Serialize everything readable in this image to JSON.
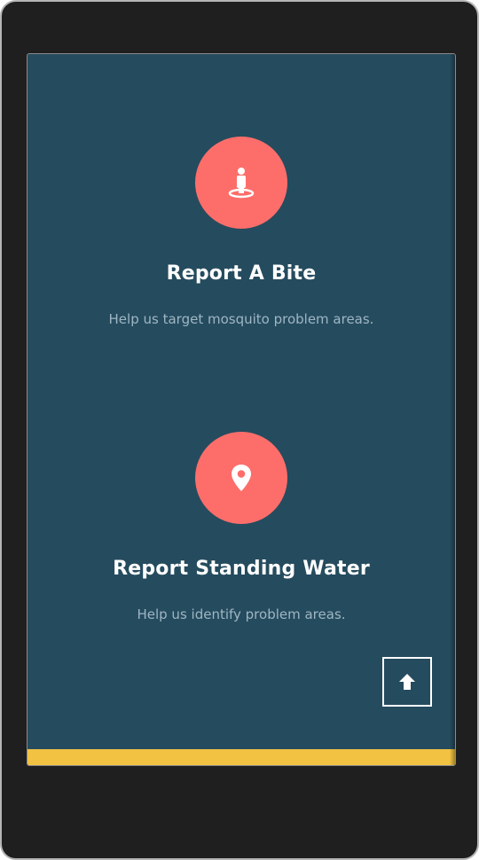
{
  "features": {
    "bite": {
      "icon": "person-location-icon",
      "title": "Report A Bite",
      "description": "Help us target mosquito problem areas."
    },
    "water": {
      "icon": "map-pin-icon",
      "title": "Report Standing Water",
      "description": "Help us identify problem areas."
    }
  },
  "scroll_top": {
    "icon": "arrow-up-icon"
  },
  "colors": {
    "background": "#254b5e",
    "accent": "#fd6e6a",
    "footer": "#f2c243",
    "description": "#9fb6c3"
  }
}
